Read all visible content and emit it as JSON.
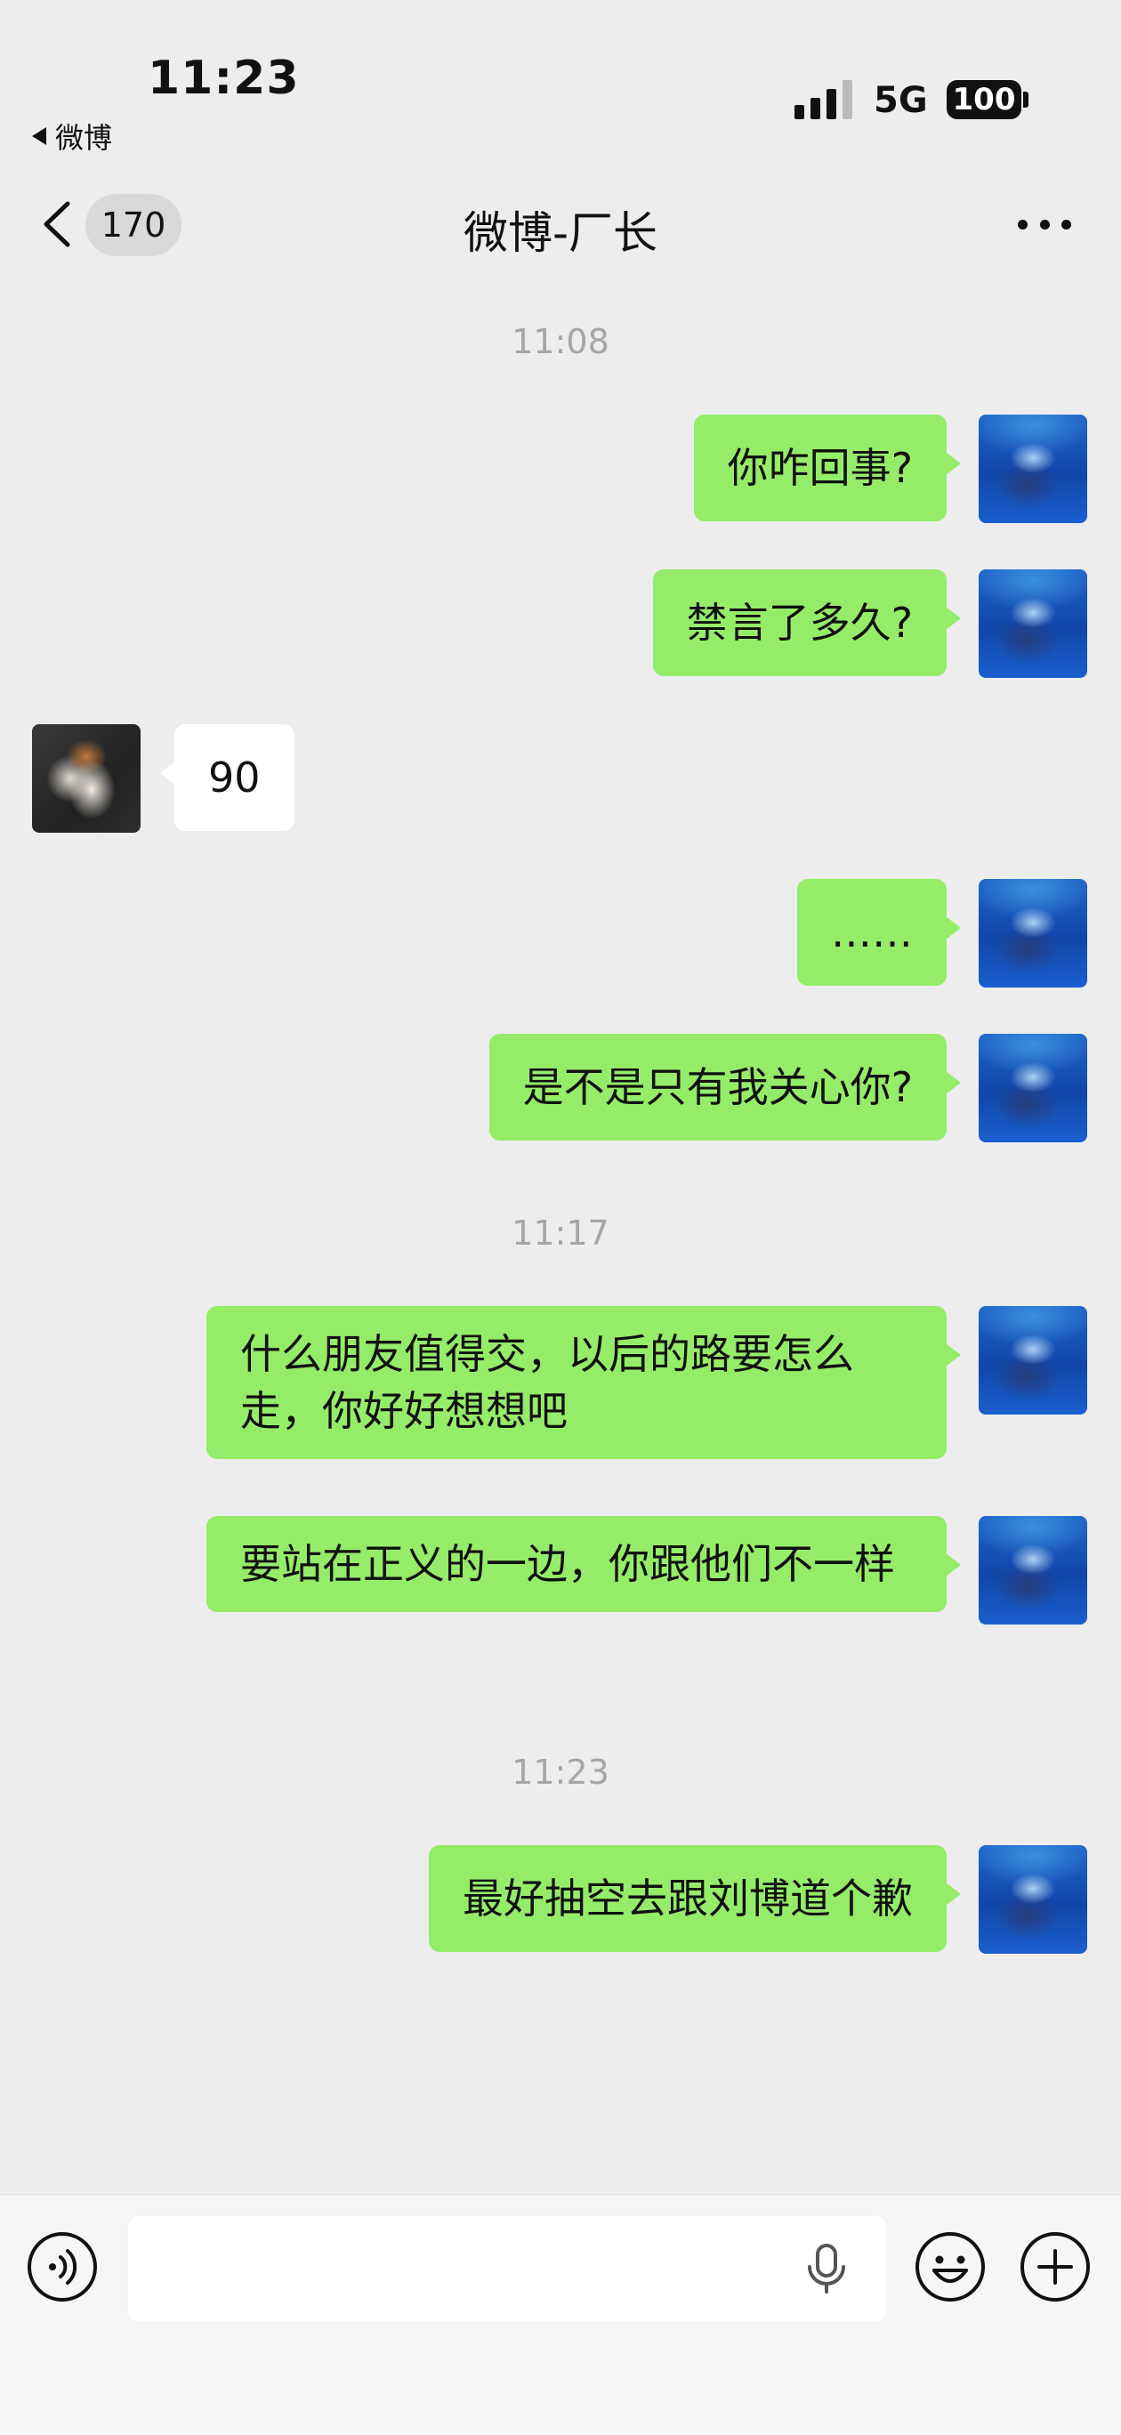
{
  "status_bar": {
    "time": "11:23",
    "back_app": "微博",
    "network": "5G",
    "battery": "100"
  },
  "nav": {
    "unread_count": "170",
    "title": "微博-厂长"
  },
  "messages": {
    "ts1": "11:08",
    "m1": "你咋回事?",
    "m2": "禁言了多久?",
    "m3": "90",
    "m4": "……",
    "m5": "是不是只有我关心你?",
    "ts2": "11:17",
    "m6": "什么朋友值得交，以后的路要怎么走，你好好想想吧",
    "m7": "要站在正义的一边，你跟他们不一样",
    "ts3": "11:23",
    "m8": "最好抽空去跟刘博道个歉"
  },
  "input_bar": {
    "text_value": ""
  },
  "icons": {
    "voice": "voice-icon",
    "mic": "mic-icon",
    "emoji": "emoji-icon",
    "plus": "plus-icon",
    "more": "more-icon",
    "back": "chevron-left-icon"
  },
  "colors": {
    "outgoing_bubble": "#95ec69",
    "incoming_bubble": "#ffffff",
    "background": "#ededed"
  }
}
